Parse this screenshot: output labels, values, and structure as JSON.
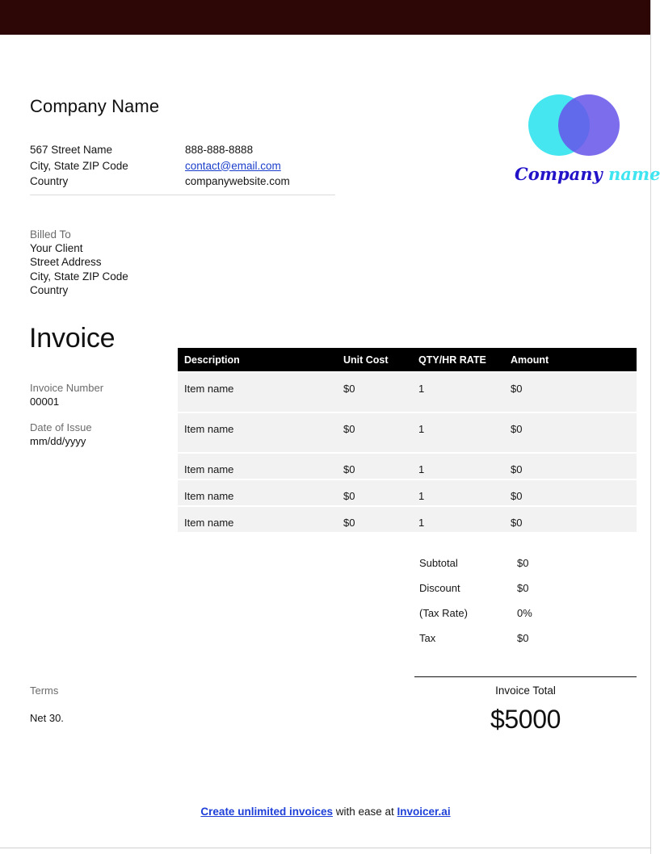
{
  "topbar": {
    "color": "#2d0606"
  },
  "company": {
    "name": "Company Name",
    "address_line1": "567 Street Name",
    "address_line2": "City, State ZIP Code",
    "address_line3": "Country",
    "phone": "888-888-8888",
    "email": "contact@email.com",
    "website": "companywebsite.com"
  },
  "logo": {
    "left_circle_color": "#45e6f0",
    "right_circle_color": "#6655ea",
    "overlap_color": "#3344e0",
    "script_word1": "Company",
    "script_word2": "name",
    "script_word1_color": "#2213c8",
    "script_word2_color": "#3fe5f0"
  },
  "billed_to": {
    "label": "Billed To",
    "line1": "Your Client",
    "line2": "Street Address",
    "line3": "City, State ZIP Code",
    "line4": "Country"
  },
  "invoice": {
    "title": "Invoice",
    "number_label": "Invoice Number",
    "number_value": "00001",
    "date_label": "Date of Issue",
    "date_value": "mm/dd/yyyy"
  },
  "table": {
    "headers": [
      "Description",
      "Unit Cost",
      "QTY/HR RATE",
      "Amount"
    ],
    "rows": [
      {
        "description": "Item name",
        "unit_cost": "$0",
        "qty": "1",
        "amount": "$0"
      },
      {
        "description": "Item name",
        "unit_cost": "$0",
        "qty": "1",
        "amount": "$0"
      },
      {
        "description": "Item name",
        "unit_cost": "$0",
        "qty": "1",
        "amount": "$0"
      },
      {
        "description": "Item name",
        "unit_cost": "$0",
        "qty": "1",
        "amount": "$0"
      },
      {
        "description": "Item name",
        "unit_cost": "$0",
        "qty": "1",
        "amount": "$0"
      }
    ]
  },
  "totals": {
    "subtotal_label": "Subtotal",
    "subtotal_value": "$0",
    "discount_label": "Discount",
    "discount_value": "$0",
    "tax_rate_label": "(Tax Rate)",
    "tax_rate_value": "0%",
    "tax_label": "Tax",
    "tax_value": "$0",
    "grand_label": "Invoice Total",
    "grand_value": "$5000"
  },
  "terms": {
    "label": "Terms",
    "value": "Net 30."
  },
  "footer": {
    "link1": "Create unlimited invoices",
    "middle": " with ease at ",
    "link2": "Invoicer.ai",
    "link_color": "#1e40d8"
  }
}
